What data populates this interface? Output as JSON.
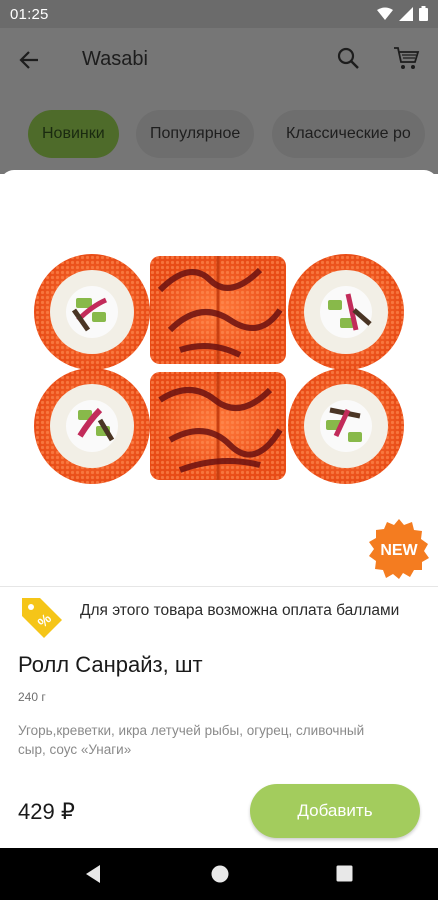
{
  "status_bar": {
    "time": "01:25"
  },
  "app_bar": {
    "title": "Wasabi"
  },
  "tabs": [
    {
      "label": "Новинки",
      "active": true
    },
    {
      "label": "Популярное",
      "active": false
    },
    {
      "label": "Классические ро",
      "active": false
    }
  ],
  "product": {
    "badge": "NEW",
    "bonus_text": "Для этого товара возможна оплата баллами",
    "title": "Ролл Санрайз, шт",
    "weight": "240 г",
    "description": "Угорь,креветки, икра летучей рыбы, огурец, сливочный сыр, соус «Унаги»",
    "price": "429 ₽",
    "add_label": "Добавить"
  },
  "colors": {
    "accent_green": "#a3cc5d",
    "badge_orange": "#f47c20",
    "bonus_yellow": "#f5c518"
  }
}
